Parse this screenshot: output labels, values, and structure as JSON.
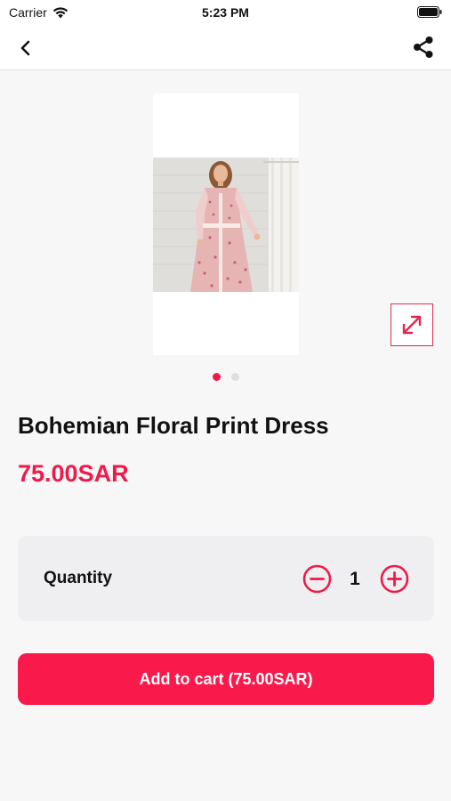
{
  "status_bar": {
    "carrier": "Carrier",
    "time": "5:23 PM",
    "wifi_icon": "wifi-icon",
    "battery_icon": "battery-icon"
  },
  "nav": {
    "back_icon": "chevron-left-icon",
    "share_icon": "share-icon"
  },
  "gallery": {
    "image_count": 2,
    "active_index": 0,
    "expand_icon": "expand-icon"
  },
  "product": {
    "title": "Bohemian Floral Print Dress",
    "price": "75.00SAR"
  },
  "quantity": {
    "label": "Quantity",
    "value": "1",
    "minus_icon": "minus-circle-icon",
    "plus_icon": "plus-circle-icon"
  },
  "cart": {
    "button_label": "Add to cart (75.00SAR)"
  },
  "colors": {
    "accent": "#f0194a",
    "button": "#f9194a",
    "background": "#f7f7f7"
  }
}
